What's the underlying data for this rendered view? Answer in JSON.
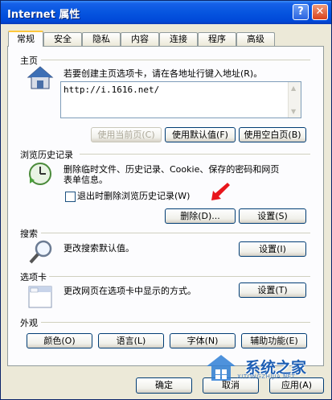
{
  "window": {
    "title": "Internet 属性",
    "help": "?",
    "close": "✕"
  },
  "tabs": [
    "常规",
    "安全",
    "隐私",
    "内容",
    "连接",
    "程序",
    "高级"
  ],
  "homepage": {
    "section": "主页",
    "desc": "若要创建主页选项卡，请在各地址行键入地址(R)。",
    "url": "http://i.1616.net/",
    "buttons": [
      "使用当前页(C)",
      "使用默认值(F)",
      "使用空白页(B)"
    ]
  },
  "history": {
    "section": "浏览历史记录",
    "desc1": "删除临时文件、历史记录、Cookie、保存的密码和网页",
    "desc2": "表单信息。",
    "checkbox_label": "退出时删除浏览历史记录(W)",
    "checked": false,
    "delete_btn": "删除(D)...",
    "settings_btn": "设置(S)"
  },
  "search": {
    "section": "搜索",
    "desc": "更改搜索默认值。",
    "settings_btn": "设置(I)"
  },
  "tabsec": {
    "section": "选项卡",
    "desc": "更改网页在选项卡中显示的方式。",
    "settings_btn": "设置(T)"
  },
  "appearance": {
    "section": "外观",
    "buttons": [
      "颜色(O)",
      "语言(L)",
      "字体(N)",
      "辅助功能(E)"
    ]
  },
  "footer": {
    "ok": "确定",
    "cancel": "取消",
    "apply": "应用(A)"
  },
  "watermark": {
    "text": "系统之家",
    "sub": "XITONGZHIJIA.NET"
  },
  "colors": {
    "titlebar": "#0655df",
    "dialog": "#ece9d8",
    "arrow": "#e8151b"
  }
}
